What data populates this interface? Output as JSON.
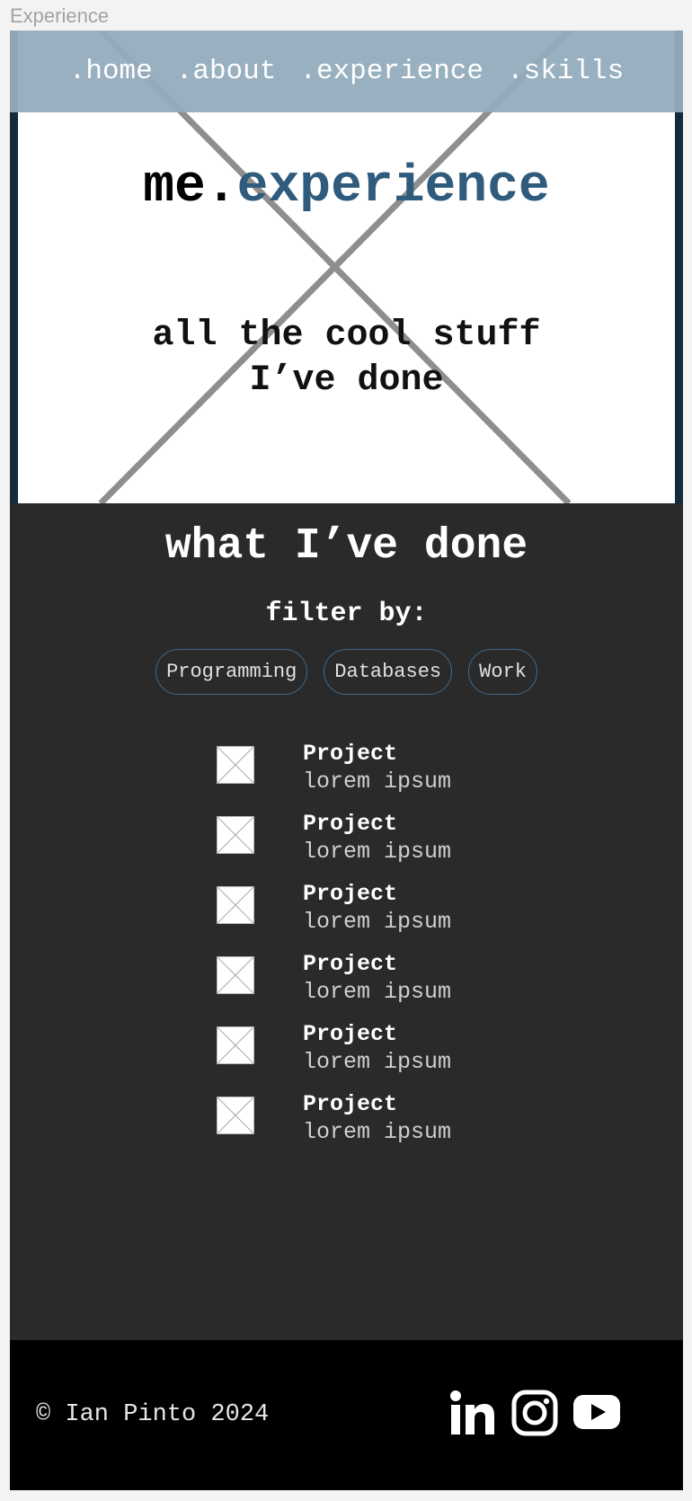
{
  "frame_label": "Experience",
  "nav": {
    "items": [
      ".home",
      ".about",
      ".experience",
      ".skills"
    ]
  },
  "hero": {
    "title_prefix": "me.",
    "title_accent": "experience",
    "subtitle_line1": "all the cool stuff",
    "subtitle_line2": "I’ve done"
  },
  "main": {
    "section_title": "what I’ve done",
    "filter_label": "filter by:",
    "filters": [
      "Programming",
      "Databases",
      "Work"
    ],
    "projects": [
      {
        "name": "Project",
        "desc": "lorem ipsum"
      },
      {
        "name": "Project",
        "desc": "lorem ipsum"
      },
      {
        "name": "Project",
        "desc": "lorem ipsum"
      },
      {
        "name": "Project",
        "desc": "lorem ipsum"
      },
      {
        "name": "Project",
        "desc": "lorem ipsum"
      },
      {
        "name": "Project",
        "desc": "lorem ipsum"
      }
    ]
  },
  "footer": {
    "copyright": "© Ian Pinto 2024",
    "social": [
      "linkedin-icon",
      "instagram-icon",
      "youtube-icon"
    ]
  },
  "colors": {
    "accent": "#2f5b7c",
    "nav_bg": "#94acbd",
    "body_bg": "#2a2a2a",
    "footer_bg": "#000000",
    "chip_border": "#3d6a8e"
  }
}
